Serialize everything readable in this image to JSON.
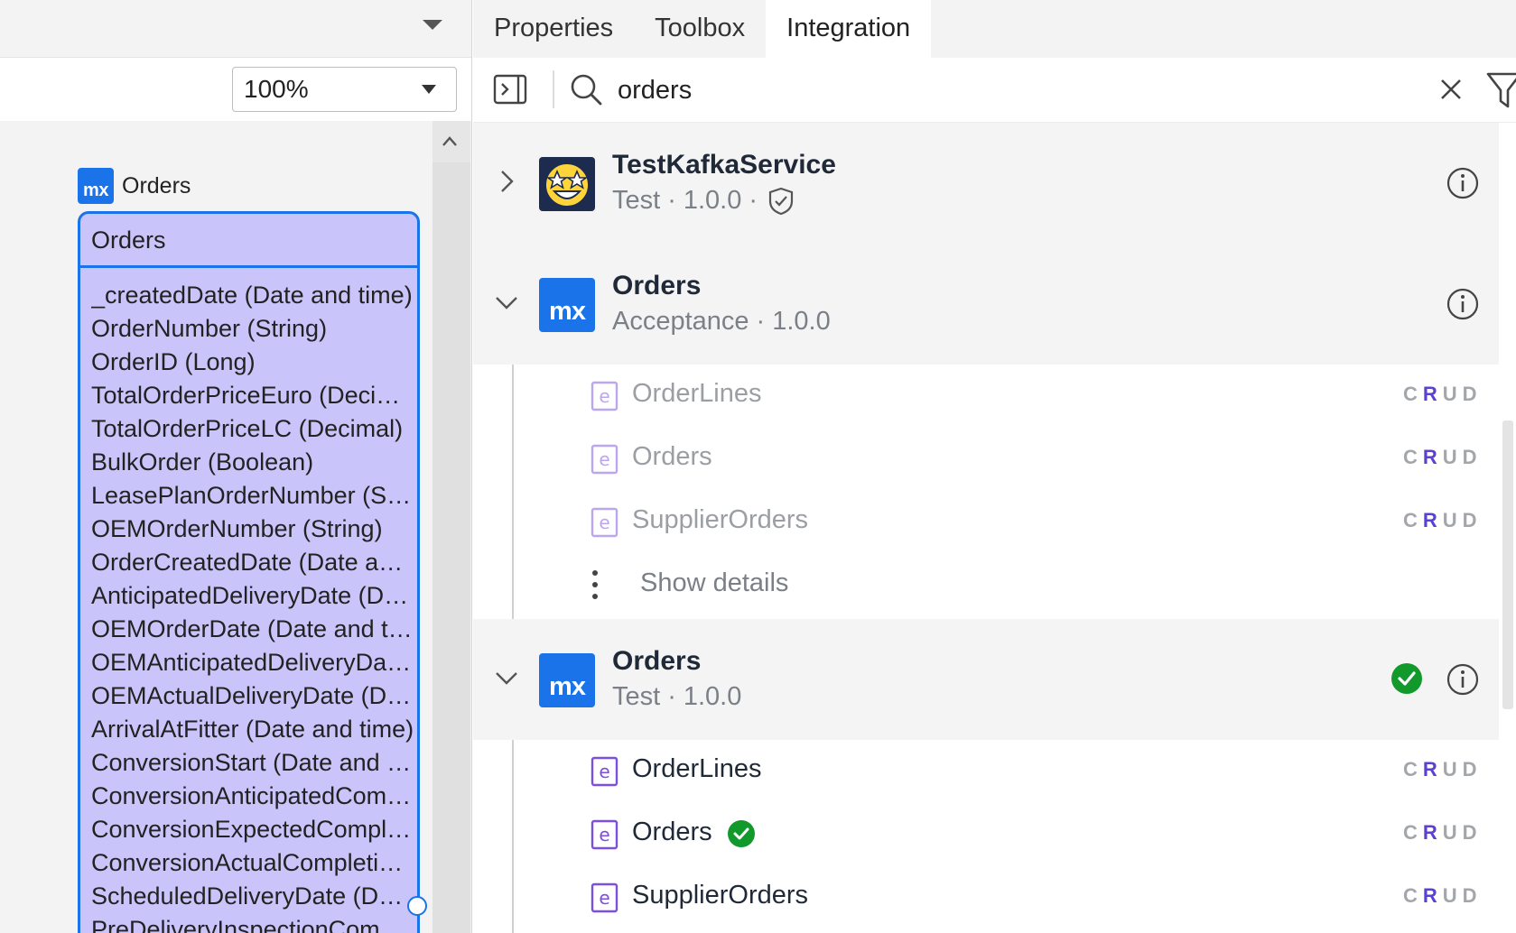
{
  "left_panel": {
    "zoom": {
      "value": "100%"
    },
    "entity": {
      "caption_badge": "mx",
      "caption": "Orders",
      "title": "Orders",
      "attributes": [
        "_createdDate (Date and time)",
        "OrderNumber (String)",
        "OrderID (Long)",
        "TotalOrderPriceEuro (Decimal)",
        "TotalOrderPriceLC (Decimal)",
        "BulkOrder (Boolean)",
        "LeasePlanOrderNumber (String)",
        "OEMOrderNumber (String)",
        "OrderCreatedDate (Date and time)",
        "AnticipatedDeliveryDate (Date and time)",
        "OEMOrderDate (Date and time)",
        "OEMAnticipatedDeliveryDate (Date and time)",
        "OEMActualDeliveryDate (Date and time)",
        "ArrivalAtFitter (Date and time)",
        "ConversionStart (Date and time)",
        "ConversionAnticipatedCompletion (Date and time)",
        "ConversionExpectedCompletion (Date and time)",
        "ConversionActualCompletion (Date and time)",
        "ScheduledDeliveryDate (Date and time)",
        "PreDeliveryInspectionCompletion (Date and time)"
      ]
    }
  },
  "tabs": [
    {
      "label": "Properties",
      "active": false
    },
    {
      "label": "Toolbox",
      "active": false
    },
    {
      "label": "Integration",
      "active": true
    }
  ],
  "search": {
    "value": "orders",
    "placeholder": "Search"
  },
  "services": [
    {
      "name": "TestKafkaService",
      "environment": "Test",
      "version": "1.0.0",
      "separator": "·",
      "expanded": false,
      "logo": "star-struck-emoji",
      "badge_icon": "shield-check-icon"
    },
    {
      "name": "Orders",
      "environment": "Acceptance",
      "version": "1.0.0",
      "separator": "·",
      "expanded": true,
      "logo_text": "mx",
      "entities": [
        {
          "name": "OrderLines",
          "crud": [
            "C",
            "R",
            "U",
            "D"
          ],
          "active": "R"
        },
        {
          "name": "Orders",
          "crud": [
            "C",
            "R",
            "U",
            "D"
          ],
          "active": "R"
        },
        {
          "name": "SupplierOrders",
          "crud": [
            "C",
            "R",
            "U",
            "D"
          ],
          "active": "R"
        }
      ],
      "show_details": "Show details"
    },
    {
      "name": "Orders",
      "environment": "Test",
      "version": "1.0.0",
      "separator": "·",
      "expanded": true,
      "logo_text": "mx",
      "in_use": true,
      "entities": [
        {
          "name": "OrderLines",
          "crud": [
            "C",
            "R",
            "U",
            "D"
          ],
          "active": "R"
        },
        {
          "name": "Orders",
          "crud": [
            "C",
            "R",
            "U",
            "D"
          ],
          "active": "R",
          "in_use": true
        },
        {
          "name": "SupplierOrders",
          "crud": [
            "C",
            "R",
            "U",
            "D"
          ],
          "active": "R"
        }
      ]
    }
  ],
  "colors": {
    "accent": "#1a73e8",
    "entity_fill": "#c9c5fb",
    "crud_active": "#5b3fd6",
    "success": "#119a2b",
    "entity_icon": "#7b4fe0"
  }
}
